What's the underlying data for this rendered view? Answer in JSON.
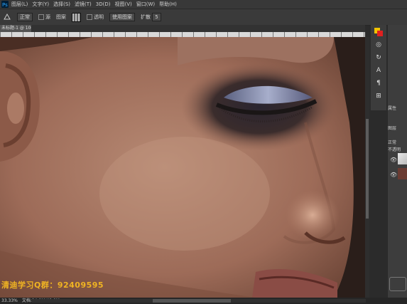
{
  "menubar": {
    "items": [
      "图层(L)",
      "文字(Y)",
      "选择(S)",
      "滤镜(T)",
      "3D(D)",
      "视图(V)",
      "窗口(W)",
      "帮助(H)"
    ]
  },
  "options": {
    "mode_value": "正常",
    "source_label": "源",
    "pattern_label": "图案",
    "transparent_label": "透明",
    "use_pattern_label": "使用图案",
    "diffusion_label": "扩散",
    "diffusion_value": "5"
  },
  "tab": {
    "title": "未标题-1 @ 100%(RGB/8)"
  },
  "watermark": {
    "text": "清迪学习Q群：92409595"
  },
  "panels": {
    "properties_label": "属性",
    "layers_label": "图层",
    "kind_label": "正常",
    "opacity_label": "不透明"
  },
  "status": {
    "zoom": "33.33%",
    "doc_info": "文档:24.0M/48.0M"
  }
}
